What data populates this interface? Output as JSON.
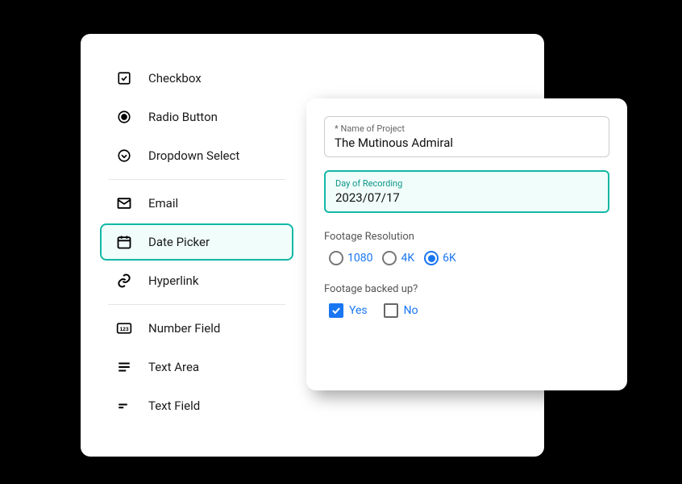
{
  "field_types": {
    "checkbox": "Checkbox",
    "radio": "Radio Button",
    "dropdown": "Dropdown Select",
    "email": "Email",
    "date_picker": "Date Picker",
    "hyperlink": "Hyperlink",
    "number": "Number Field",
    "textarea": "Text Area",
    "textfield": "Text Field"
  },
  "form": {
    "project_name": {
      "label": "* Name of Project",
      "value": "The Mutinous Admiral"
    },
    "recording_day": {
      "label": "Day of Recording",
      "value": "2023/07/17"
    },
    "resolution": {
      "label": "Footage Resolution",
      "options": {
        "r1080": "1080",
        "r4k": "4K",
        "r6k": "6K"
      },
      "selected": "6K"
    },
    "backed_up": {
      "label": "Footage backed up?",
      "options": {
        "yes": "Yes",
        "no": "No"
      }
    }
  }
}
